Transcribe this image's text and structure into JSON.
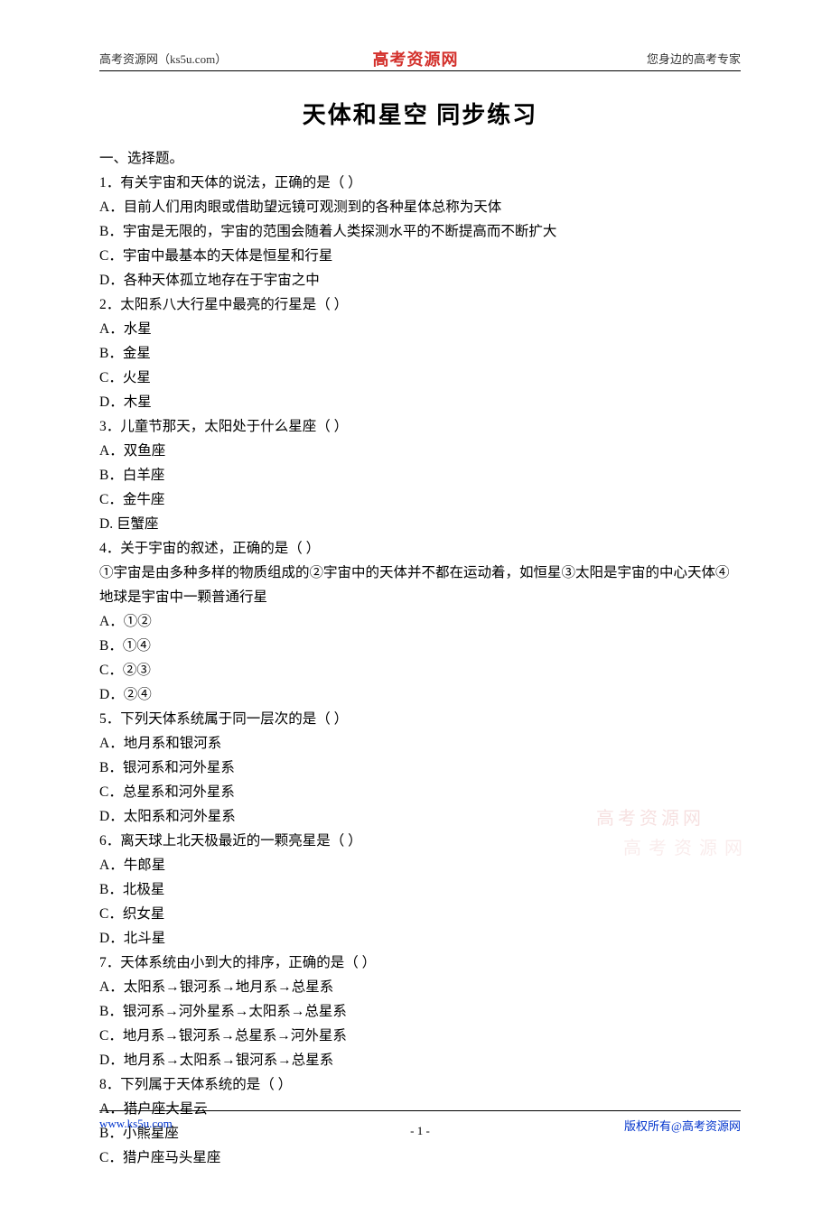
{
  "header": {
    "left": "高考资源网（ks5u.com）",
    "center": "高考资源网",
    "right": "您身边的高考专家"
  },
  "title": "天体和星空 同步练习",
  "section_heading": "一、选择题。",
  "questions": [
    {
      "stem": "1．有关宇宙和天体的说法，正确的是（ ）",
      "options": [
        "A．目前人们用肉眼或借助望远镜可观测到的各种星体总称为天体",
        "B．宇宙是无限的，宇宙的范围会随着人类探测水平的不断提高而不断扩大",
        "C．宇宙中最基本的天体是恒星和行星",
        "D．各种天体孤立地存在于宇宙之中"
      ]
    },
    {
      "stem": "2．太阳系八大行星中最亮的行星是（ ）",
      "options": [
        "A．水星",
        "B．金星",
        "C．火星",
        "D．木星"
      ]
    },
    {
      "stem": "3．儿童节那天，太阳处于什么星座（ ）",
      "options": [
        "A．双鱼座",
        "B．白羊座",
        "C．金牛座",
        "D. 巨蟹座"
      ]
    },
    {
      "stem": "4．关于宇宙的叙述，正确的是（ ）",
      "extra": "①宇宙是由多种多样的物质组成的②宇宙中的天体并不都在运动着，如恒星③太阳是宇宙的中心天体④地球是宇宙中一颗普通行星",
      "options": [
        "A．①②",
        "B．①④",
        "C．②③",
        "D．②④"
      ]
    },
    {
      "stem": "5．下列天体系统属于同一层次的是（ ）",
      "options": [
        "A．地月系和银河系",
        "B．银河系和河外星系",
        "C．总星系和河外星系",
        "D．太阳系和河外星系"
      ]
    },
    {
      "stem": "6．离天球上北天极最近的一颗亮星是（ ）",
      "options": [
        "A．牛郎星",
        "B．北极星",
        "C．织女星",
        "D．北斗星"
      ]
    },
    {
      "stem": "7．天体系统由小到大的排序，正确的是（ ）",
      "options": [
        "A．太阳系→银河系→地月系→总星系",
        "B．银河系→河外星系→太阳系→总星系",
        "C．地月系→银河系→总星系→河外星系",
        "D．地月系→太阳系→银河系→总星系"
      ]
    },
    {
      "stem": "8．下列属于天体系统的是（ ）",
      "options": [
        "A．猎户座大星云",
        "B．小熊星座",
        "C．猎户座马头星座"
      ]
    }
  ],
  "watermark": {
    "line1": "高考资源网",
    "line2": "高考资源网"
  },
  "footer": {
    "left": "www.ks5u.com",
    "page": "- 1 -",
    "right": "版权所有@高考资源网"
  }
}
